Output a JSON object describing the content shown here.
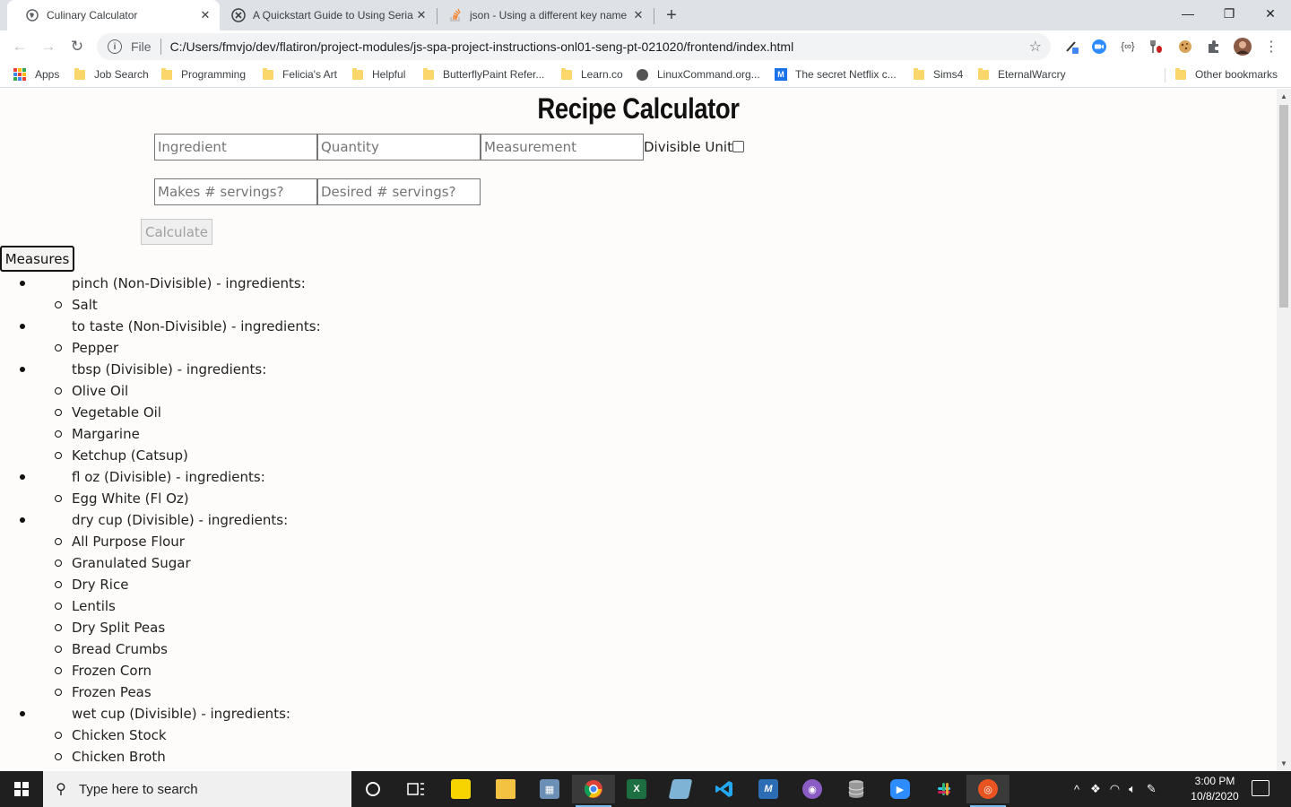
{
  "browser": {
    "tabs": [
      {
        "title": "Culinary Calculator",
        "icon": "globe-icon"
      },
      {
        "title": "A Quickstart Guide to Using Seria",
        "icon": "x-circle-icon"
      },
      {
        "title": "json - Using a different key name",
        "icon": "stackoverflow-icon"
      }
    ],
    "address": {
      "scheme": "File",
      "url": "C:/Users/fmvjo/dev/flatiron/project-modules/js-spa-project-instructions-onl01-seng-pt-021020/frontend/index.html"
    },
    "bookmarks": [
      {
        "label": "Apps",
        "icon": "apps-icon"
      },
      {
        "label": "Job Search",
        "icon": "folder-icon"
      },
      {
        "label": "Programming",
        "icon": "folder-icon"
      },
      {
        "label": "Felicia's Art",
        "icon": "folder-icon"
      },
      {
        "label": "Helpful",
        "icon": "folder-icon"
      },
      {
        "label": "ButterflyPaint Refer...",
        "icon": "folder-icon"
      },
      {
        "label": "Learn.co",
        "icon": "folder-icon"
      },
      {
        "label": "LinuxCommand.org...",
        "icon": "globe-icon"
      },
      {
        "label": "The secret Netflix c...",
        "icon": "medium-icon"
      },
      {
        "label": "Sims4",
        "icon": "folder-icon"
      },
      {
        "label": "EternalWarcry",
        "icon": "folder-icon"
      },
      {
        "label": "Other bookmarks",
        "icon": "folder-icon"
      }
    ]
  },
  "page": {
    "title": "Recipe Calculator",
    "form": {
      "ingredient_placeholder": "Ingredient",
      "quantity_placeholder": "Quantity",
      "measurement_placeholder": "Measurement",
      "divisible_label": "Divisible Unit?",
      "makes_placeholder": "Makes # servings?",
      "desired_placeholder": "Desired # servings?",
      "calculate_label": "Calculate"
    },
    "measures_button": "Measures",
    "measures": [
      {
        "header": "pinch (Non-Divisible) - ingredients:",
        "ingredients": [
          "Salt"
        ]
      },
      {
        "header": "to taste (Non-Divisible) - ingredients:",
        "ingredients": [
          "Pepper"
        ]
      },
      {
        "header": "tbsp (Divisible) - ingredients:",
        "ingredients": [
          "Olive Oil",
          "Vegetable Oil",
          "Margarine",
          "Ketchup (Catsup)"
        ]
      },
      {
        "header": "fl oz (Divisible) - ingredients:",
        "ingredients": [
          "Egg White (Fl Oz)"
        ]
      },
      {
        "header": "dry cup (Divisible) - ingredients:",
        "ingredients": [
          "All Purpose Flour",
          "Granulated Sugar",
          "Dry Rice",
          "Lentils",
          "Dry Split Peas",
          "Bread Crumbs",
          "Frozen Corn",
          "Frozen Peas"
        ]
      },
      {
        "header": "wet cup (Divisible) - ingredients:",
        "ingredients": [
          "Chicken Stock",
          "Chicken Broth"
        ]
      }
    ]
  },
  "taskbar": {
    "search_placeholder": "Type here to search",
    "time": "3:00 PM",
    "date": "10/8/2020"
  }
}
